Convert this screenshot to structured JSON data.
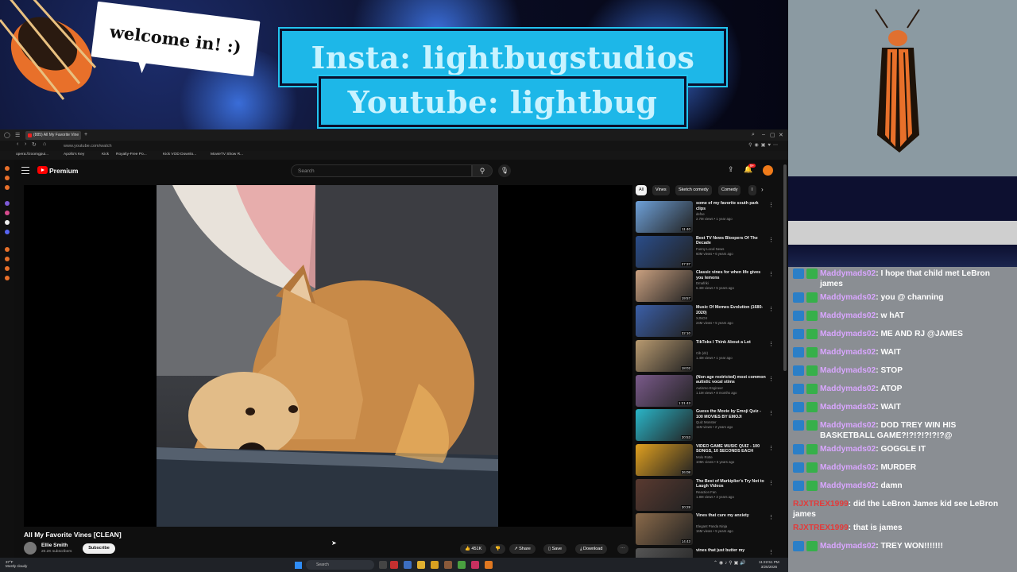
{
  "overlay": {
    "welcome_text": "welcome in! :)",
    "insta_text": "Insta: lightbugstudios",
    "youtube_text": "Youtube: lightbug"
  },
  "chat": {
    "messages": [
      {
        "user": "Maddymads02",
        "text": ": I hope that child met LeBron james"
      },
      {
        "user": "Maddymads02",
        "text": ": you @ channing"
      },
      {
        "user": "Maddymads02",
        "text": ": w hAT"
      },
      {
        "user": "Maddymads02",
        "text": ": ME AND RJ @JAMES"
      },
      {
        "user": "Maddymads02",
        "text": ": WAIT"
      },
      {
        "user": "Maddymads02",
        "text": ": STOP"
      },
      {
        "user": "Maddymads02",
        "text": ": ATOP"
      },
      {
        "user": "Maddymads02",
        "text": ": WAIT"
      },
      {
        "user": "Maddymads02",
        "text": ": DOD TREY WIN HIS BASKETBALL GAME?!?!?!?!?!?@"
      },
      {
        "user": "Maddymads02",
        "text": ": GOGGLE IT"
      },
      {
        "user": "Maddymads02",
        "text": ": MURDER"
      },
      {
        "user": "Maddymads02",
        "text": ": damn"
      },
      {
        "user": "RJXTREX1999",
        "text": ": did the LeBron James kid see LeBron james"
      },
      {
        "user": "RJXTREX1999",
        "text": ": that is james"
      },
      {
        "user": "Maddymads02",
        "text": ": TREY WON!!!!!!!"
      }
    ]
  },
  "browser": {
    "tab_title": "(885) All My Favorite Vine",
    "url": "www.youtube.com/watch",
    "bookmarks": [
      "opera://zoomgpui...",
      "Apollo's Key",
      "Kick",
      "Royalty-Free Po...",
      "Kick VOD Downlo...",
      "MovieTV Show R..."
    ]
  },
  "youtube": {
    "brand": "Premium",
    "search_placeholder": "Search",
    "notif_count": "9+",
    "video_title": "All My Favorite Vines [CLEAN]",
    "channel_name": "Ellie Smith",
    "channel_subs": "20.2K subscribers",
    "subscribe_label": "Subscribe",
    "likes": "451K",
    "share_label": "Share",
    "save_label": "Save",
    "download_label": "Download",
    "chips": [
      "All",
      "Vines",
      "Sketch comedy",
      "Comedy",
      "I"
    ],
    "recommendations": [
      {
        "title": "some of my favorite south park clips",
        "channel": "defne",
        "views": "2.7M views • 1 year ago",
        "duration": "11:40",
        "color": "#6ea0d8"
      },
      {
        "title": "Best TV News Bloopers Of The Decade",
        "channel": "Funny Local News",
        "views": "60M views • 6 years ago",
        "duration": "27:37",
        "color": "#2a4d8a"
      },
      {
        "title": "Classic vines for when life gives you lemons",
        "channel": "Dmafriki",
        "views": "6.4M views • 5 years ago",
        "duration": "19:57",
        "color": "#c9a080"
      },
      {
        "title": "Music Of Memes Evolution (1680-2020)",
        "channel": "XJNOX",
        "views": "24M views • 5 years ago",
        "duration": "22:10",
        "color": "#3b5fa8"
      },
      {
        "title": "TikToks I Think About a Lot",
        "channel": "Cib (dc)",
        "views": "1.4M views • 1 year ago",
        "duration": "18:02",
        "color": "#b89a70"
      },
      {
        "title": "(Non age restricted) most common autistic vocal stims",
        "channel": "Autismo Engineer",
        "views": "1.1M views • 8 months ago",
        "duration": "1:21:43",
        "color": "#7a5a8a"
      },
      {
        "title": "Guess the Movie by Emoji Quiz - 100 MOVIES BY EMOJI",
        "channel": "Quiz Monster",
        "views": "11M views • 2 years ago",
        "duration": "20:53",
        "color": "#2ab5c8"
      },
      {
        "title": "VIDEO GAME MUSIC QUIZ - 100 SONGS, 10 SECONDS EACH",
        "channel": "Molo Rotte",
        "views": "105K views • 5 years ago",
        "duration": "26:08",
        "color": "#e0a020"
      },
      {
        "title": "The Best of Markiplier's Try Not to Laugh Videos",
        "channel": "Reaction Fan",
        "views": "1.8M views • 3 years ago",
        "duration": "20:28",
        "color": "#5a3a30"
      },
      {
        "title": "Vines that cure my anxiety",
        "channel": "Elegant Panda Ninja",
        "views": "16M views • 5 years ago",
        "duration": "14:43",
        "color": "#8a6a4a"
      },
      {
        "title": "vines that just butter my",
        "channel": "",
        "views": "",
        "duration": "",
        "color": "#555555"
      }
    ]
  },
  "taskbar": {
    "weather_temp": "37°F",
    "weather_desc": "Mostly cloudy",
    "search_label": "Search",
    "time": "11:22:51 PM",
    "date": "3/25/2026"
  }
}
